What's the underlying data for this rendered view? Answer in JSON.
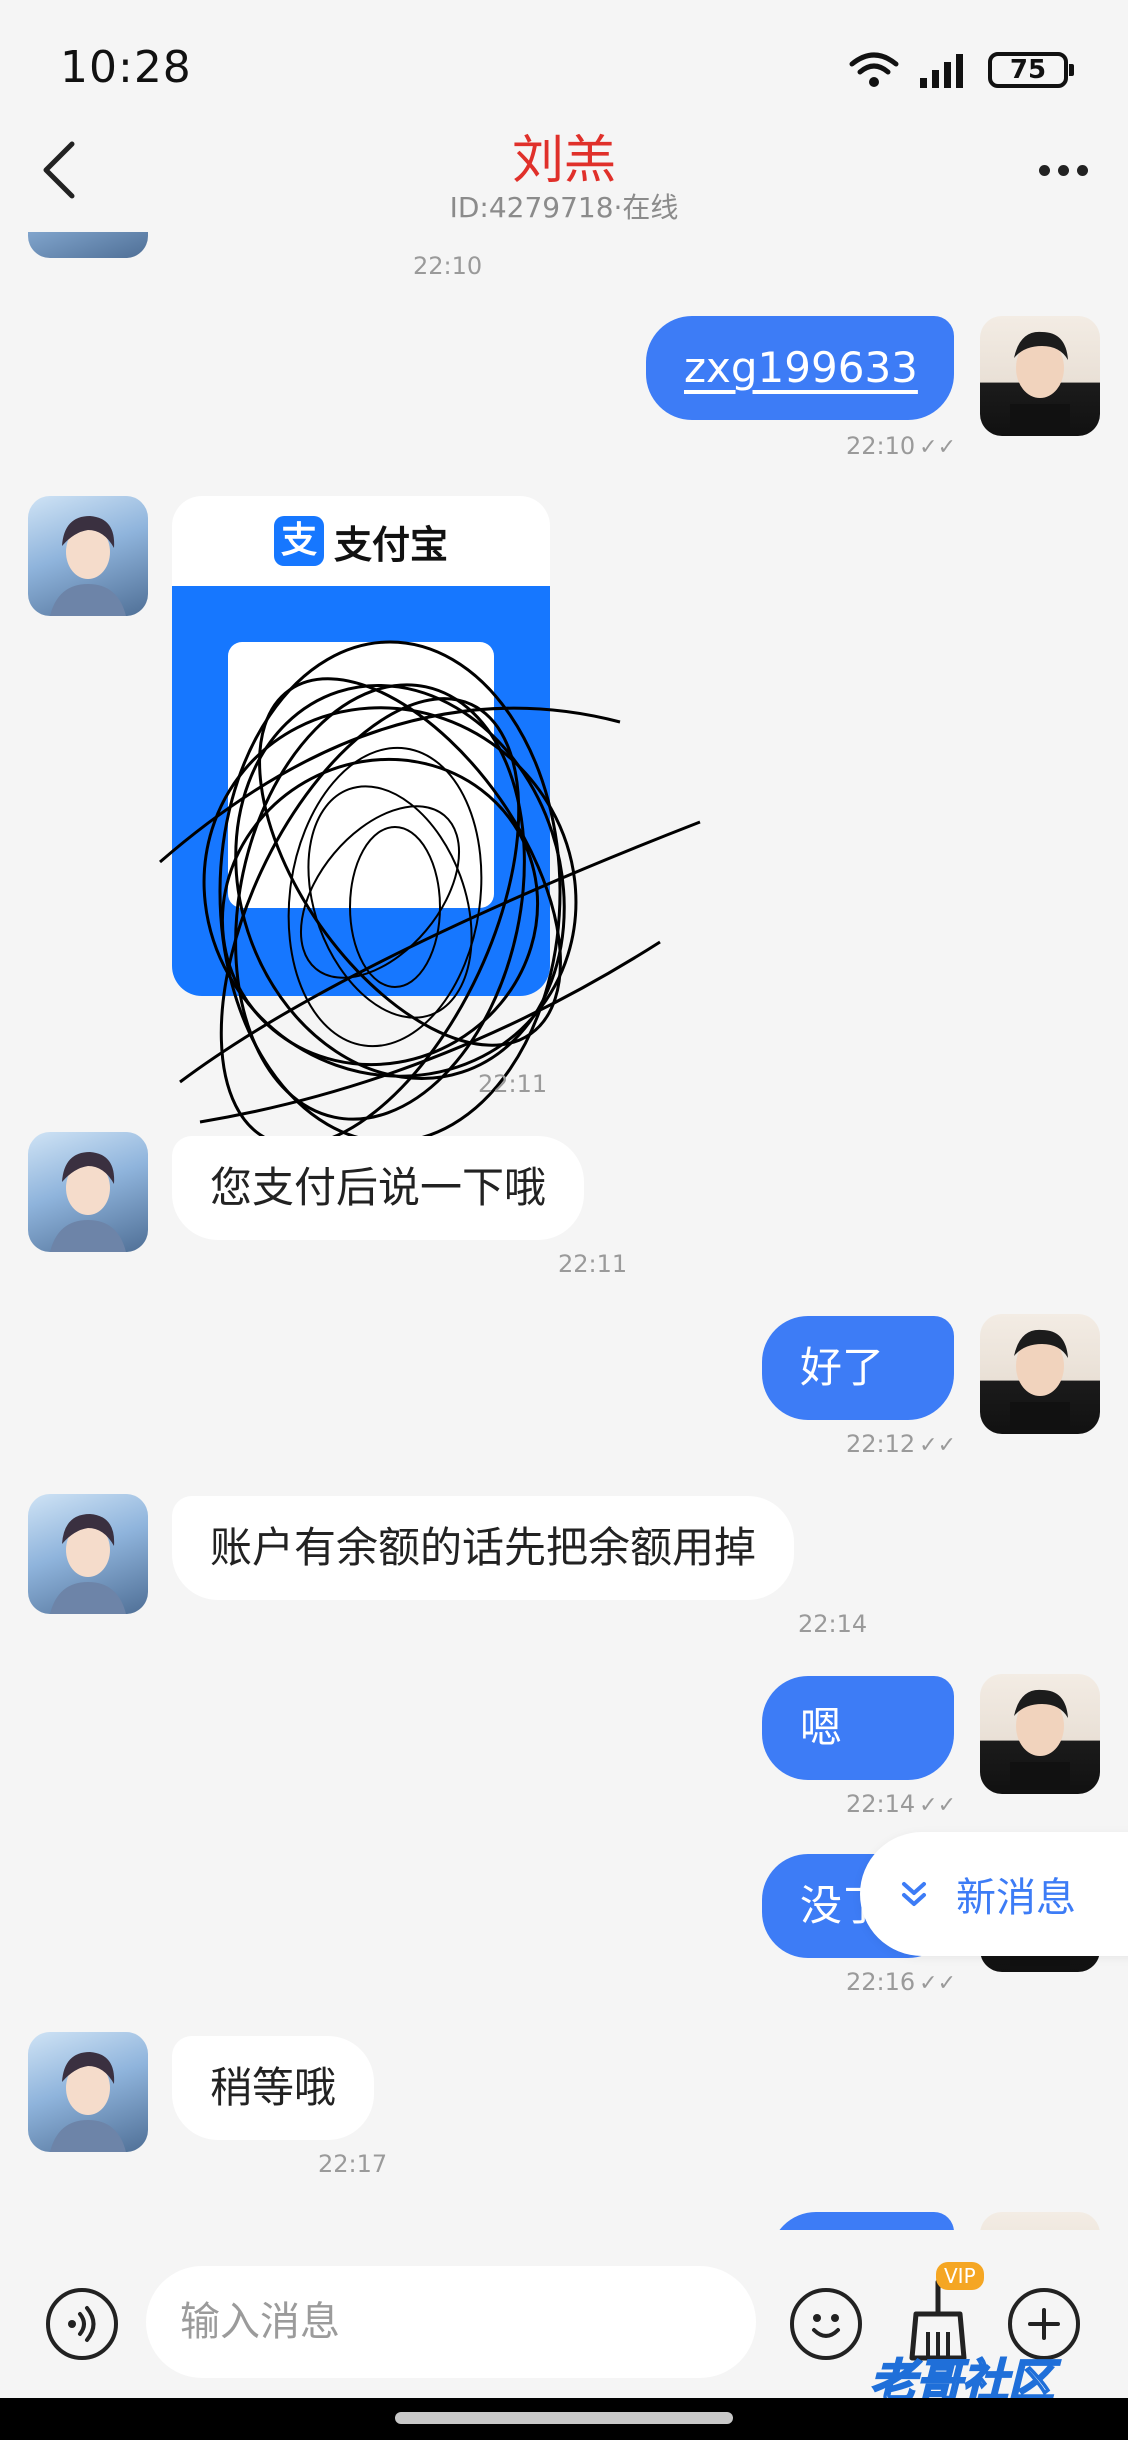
{
  "status_bar": {
    "time": "10:28",
    "network_label": "5A",
    "wifi_label": "6",
    "battery": "75"
  },
  "header": {
    "contact_name": "刘羔",
    "contact_sub": "ID:4279718·在线"
  },
  "messages": [
    {
      "side": "other",
      "type": "partial",
      "time": "22:10"
    },
    {
      "side": "self",
      "type": "text",
      "text": "zxg199633",
      "time": "22:10",
      "read": true
    },
    {
      "side": "other",
      "type": "alipay_card",
      "brand": "支付宝",
      "time": "22:11"
    },
    {
      "side": "other",
      "type": "text",
      "text": "您支付后说一下哦",
      "time": "22:11"
    },
    {
      "side": "self",
      "type": "text",
      "text": "好了",
      "time": "22:12",
      "read": true
    },
    {
      "side": "other",
      "type": "text",
      "text": "账户有余额的话先把余额用掉",
      "time": "22:14"
    },
    {
      "side": "self",
      "type": "text",
      "text": "嗯",
      "time": "22:14",
      "read": true
    },
    {
      "side": "self",
      "type": "text",
      "text": "没了",
      "time": "22:16",
      "read": true
    },
    {
      "side": "other",
      "type": "text",
      "text": "稍等哦",
      "time": "22:17"
    }
  ],
  "new_message_pill": {
    "label": "新消息"
  },
  "input_bar": {
    "placeholder": "输入消息",
    "vip_badge": "VIP"
  },
  "watermark": "老哥社区",
  "colors": {
    "accent": "#3d7cf6",
    "name_red": "#e0302a",
    "alipay_blue": "#1677ff",
    "background": "#f5f5f5"
  }
}
